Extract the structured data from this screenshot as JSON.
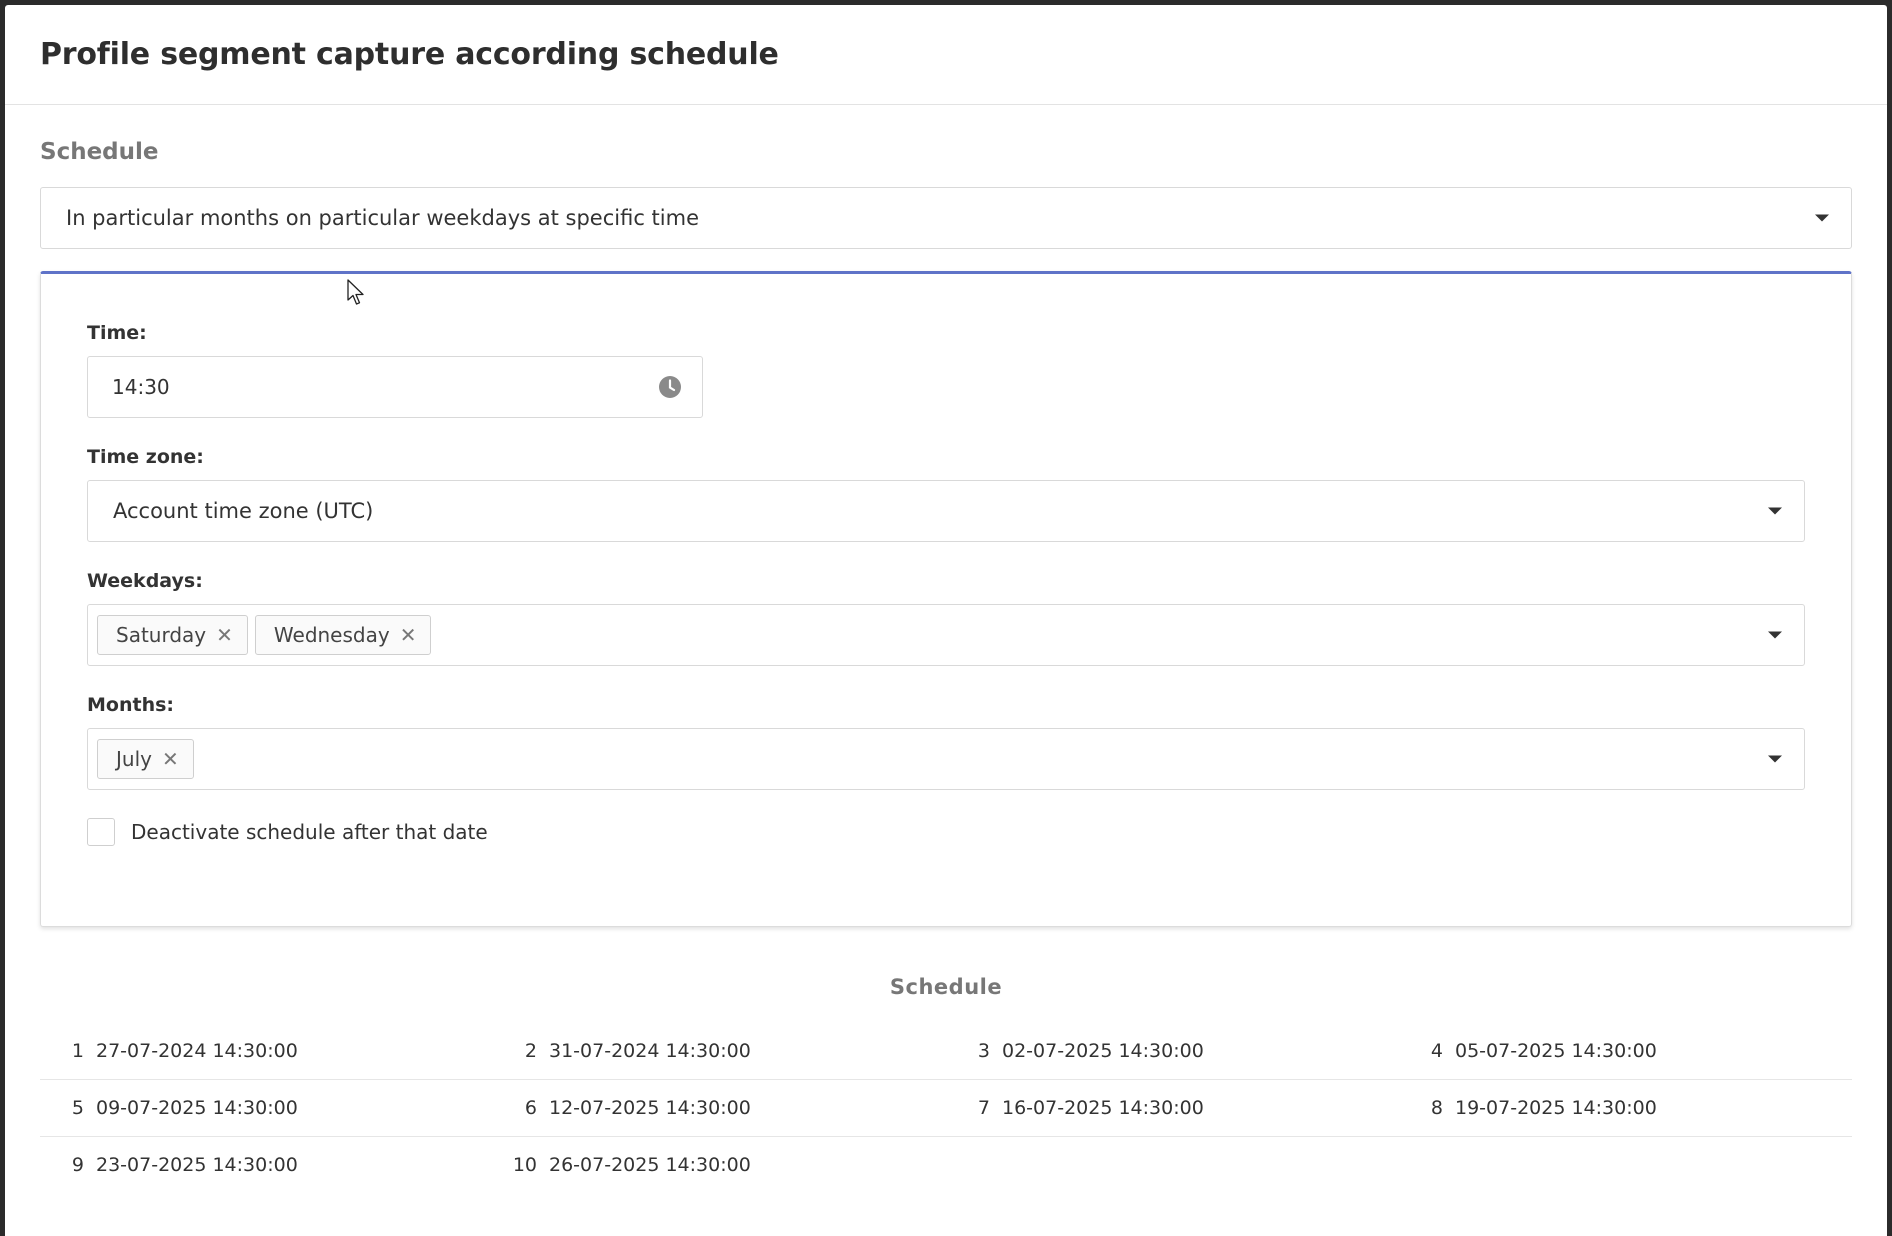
{
  "modal": {
    "title": "Profile segment capture according schedule"
  },
  "schedule_section": {
    "label": "Schedule",
    "type_select": {
      "value": "In particular months on particular weekdays at specific time"
    }
  },
  "form": {
    "time": {
      "label": "Time:",
      "value": "14:30",
      "icon": "clock-icon"
    },
    "timezone": {
      "label": "Time zone:",
      "value": "Account time zone (UTC)"
    },
    "weekdays": {
      "label": "Weekdays:",
      "chips": [
        "Saturday",
        "Wednesday"
      ]
    },
    "months": {
      "label": "Months:",
      "chips": [
        "July"
      ]
    },
    "deactivate": {
      "label": "Deactivate schedule after that date",
      "checked": false
    }
  },
  "schedule_list": {
    "title": "Schedule",
    "rows": [
      [
        {
          "index": "1",
          "date": "27-07-2024 14:30:00"
        },
        {
          "index": "2",
          "date": "31-07-2024 14:30:00"
        },
        {
          "index": "3",
          "date": "02-07-2025 14:30:00"
        },
        {
          "index": "4",
          "date": "05-07-2025 14:30:00"
        }
      ],
      [
        {
          "index": "5",
          "date": "09-07-2025 14:30:00"
        },
        {
          "index": "6",
          "date": "12-07-2025 14:30:00"
        },
        {
          "index": "7",
          "date": "16-07-2025 14:30:00"
        },
        {
          "index": "8",
          "date": "19-07-2025 14:30:00"
        }
      ],
      [
        {
          "index": "9",
          "date": "23-07-2025 14:30:00"
        },
        {
          "index": "10",
          "date": "26-07-2025 14:30:00"
        }
      ]
    ]
  },
  "colors": {
    "accent": "#5f73c8",
    "border": "#d9d9d9",
    "label_muted": "#777777"
  }
}
